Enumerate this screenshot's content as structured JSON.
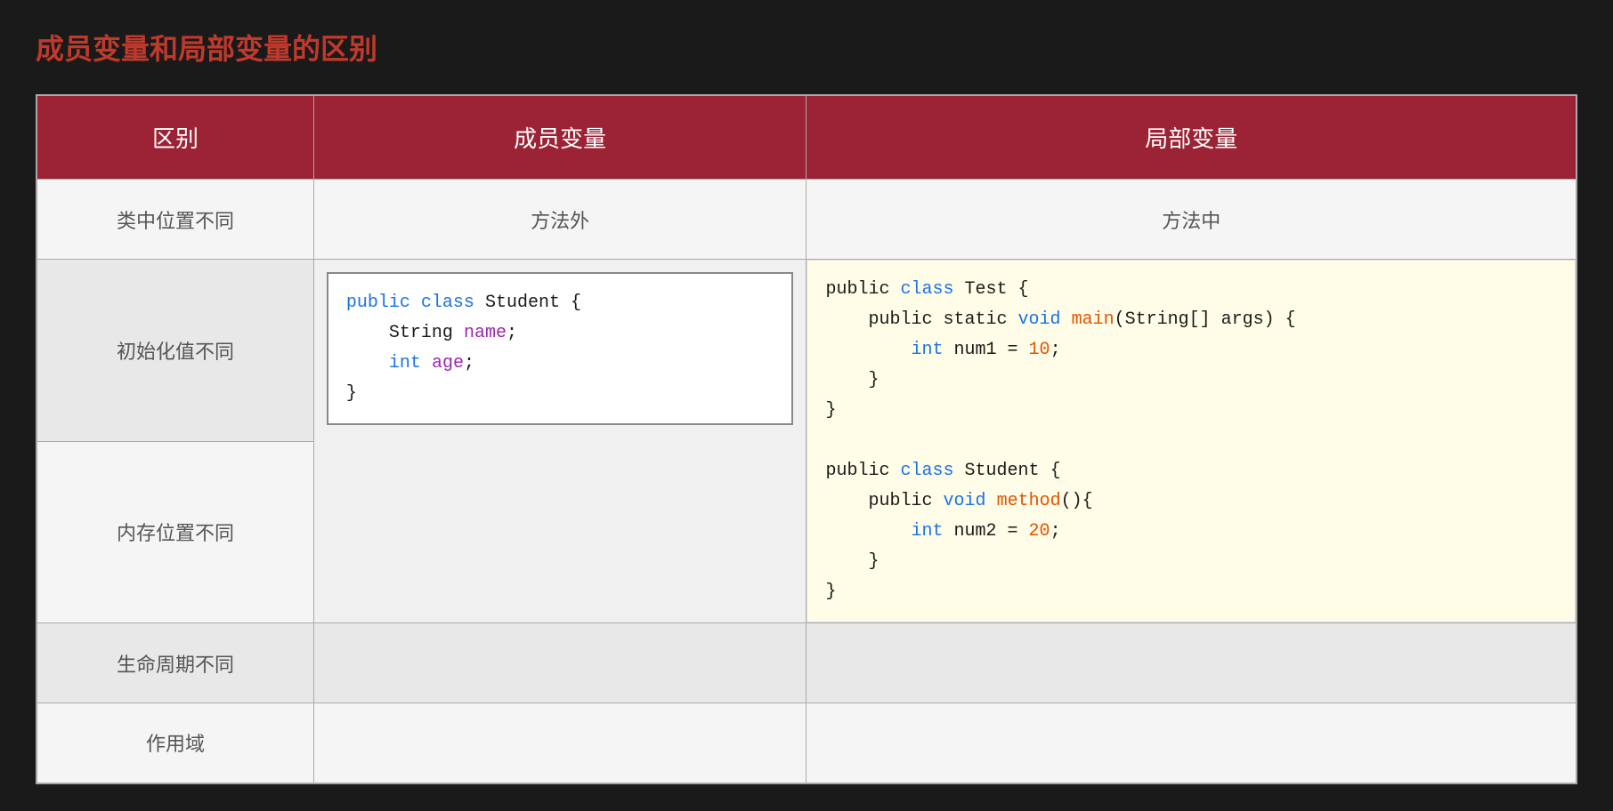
{
  "title": "成员变量和局部变量的区别",
  "table": {
    "headers": [
      "区别",
      "成员变量",
      "局部变量"
    ],
    "rows": [
      {
        "distinction": "类中位置不同",
        "member": "方法外",
        "local": "方法中",
        "type": "simple"
      },
      {
        "distinction": "初始化值不同",
        "type": "code"
      },
      {
        "distinction": "内存位置不同",
        "type": "code-cont"
      },
      {
        "distinction": "生命周期不同",
        "type": "simple",
        "member": "",
        "local": ""
      },
      {
        "distinction": "作用域",
        "type": "simple",
        "member": "",
        "local": ""
      }
    ]
  },
  "code": {
    "member_code": [
      "public class Student {",
      "    String name;",
      "    int age;",
      "}"
    ],
    "local_code_part1": [
      "public class Test {",
      "    public static void main(String[] args) {",
      "        int num1 = 10;",
      "    }",
      "}"
    ],
    "local_code_part2": [
      "public class Student {",
      "    public void method(){",
      "        int num2 = 20;",
      "    }",
      "}"
    ]
  }
}
